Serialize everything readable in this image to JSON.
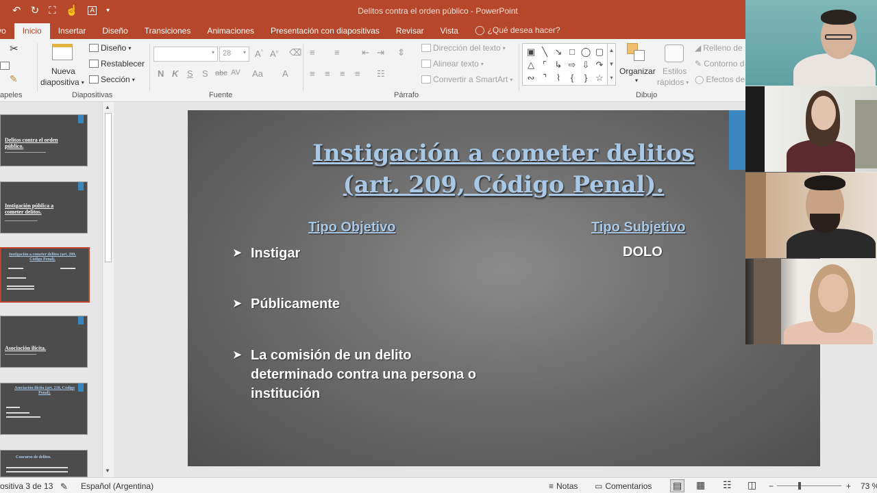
{
  "window": {
    "title": "Delitos contra el orden público - PowerPoint",
    "accent_color": "#b7472a"
  },
  "quick_access": [
    {
      "icon": "undo-icon",
      "glyph": "↶"
    },
    {
      "icon": "redo-icon",
      "glyph": "↻"
    },
    {
      "icon": "present-from-start-icon",
      "glyph": "⛶"
    },
    {
      "icon": "touch-mode-icon",
      "glyph": "☝"
    },
    {
      "icon": "font-color-box-icon",
      "glyph": "A"
    },
    {
      "icon": "customize-qat-icon",
      "glyph": "▾"
    }
  ],
  "tabs": {
    "archivo": "vo",
    "inicio": "Inicio",
    "insertar": "Insertar",
    "diseno": "Diseño",
    "transiciones": "Transiciones",
    "animaciones": "Animaciones",
    "presentacion": "Presentación con diapositivas",
    "revisar": "Revisar",
    "vista": "Vista",
    "tellme": "¿Qué desea hacer?"
  },
  "ribbon": {
    "clipboard": {
      "label": "apeles"
    },
    "slides": {
      "label": "Diapositivas",
      "new_slide_1": "Nueva",
      "new_slide_2": "diapositiva",
      "layout": "Diseño",
      "reset": "Restablecer",
      "section": "Sección"
    },
    "font": {
      "label": "Fuente",
      "font_name": "",
      "font_size": "28",
      "bold": "N",
      "italic": "K",
      "underline": "S",
      "shadow": "S",
      "strike": "abc",
      "spacing": "AV",
      "case": "Aa",
      "color": "A"
    },
    "paragraph": {
      "label": "Párrafo",
      "text_direction": "Dirección del texto",
      "align_text": "Alinear texto",
      "smartart": "Convertir a SmartArt"
    },
    "drawing": {
      "label": "Dibujo",
      "arrange": "Organizar",
      "quick_styles_1": "Estilos",
      "quick_styles_2": "rápidos",
      "shape_fill": "Relleno de",
      "shape_outline": "Contorno d",
      "shape_effects": "Efectos de"
    }
  },
  "thumbnails": [
    {
      "title": "Delitos contra el orden público."
    },
    {
      "title": "Instigación pública a cometer delitos."
    },
    {
      "title": "Instigación a cometer delitos (art. 209, Código Penal)."
    },
    {
      "title": "Asociación ilícita."
    },
    {
      "title": "Asociación ilícita (art. 210, Código Penal)."
    },
    {
      "title": "Concurso de delitos."
    }
  ],
  "slide": {
    "title_line1": "Instigación a cometer delitos",
    "title_line2": "(art. 209, Código Penal).",
    "col_objetivo": "Tipo Objetivo",
    "col_subjetivo": "Tipo Subjetivo",
    "bullets": [
      "Instigar",
      "Públicamente",
      "La comisión de un delito",
      "determinado contra una persona o",
      "institución"
    ],
    "dolo": "DOLO",
    "title_color": "#a9c8e6",
    "accent_bar_color": "#3a87c0"
  },
  "statusbar": {
    "slide_counter": "ositiva 3 de 13",
    "language": "Español (Argentina)",
    "notes": "Notas",
    "comments": "Comentarios",
    "zoom_minus": "−",
    "zoom_plus": "+",
    "zoom": "73 %"
  }
}
